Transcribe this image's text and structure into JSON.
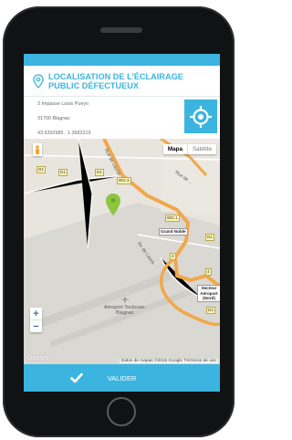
{
  "header": {
    "title": "LOCALISATION DE L’ÉCLAIRAGE PUBLIC DÉFECTUEUX",
    "pin_icon": "map-pin-icon"
  },
  "address": {
    "street": "3 Impasse Louis Pueyo",
    "city": "31700 Blagnac",
    "coordinates": "43.6392985 , 1.3682219"
  },
  "locate_button": {
    "icon": "crosshair-locate-icon"
  },
  "map": {
    "type_map": "Mapa",
    "type_satellite": "Satélite",
    "road_labels": [
      "902.3",
      "902.1",
      "D1",
      "D1",
      "D1",
      "D1",
      "4",
      "4",
      "D1"
    ],
    "place_labels": [
      "Rue de Lauras",
      "Av. de Lauris",
      "Rue de ..."
    ],
    "grand_noble": "Grand Noble",
    "secteur": "Secteur Aéroport (Nord)",
    "airport_name": "Aéroport Toulouse-Blagnac",
    "google": "Google",
    "attribution": "Datos de mapas ©2015 Google  Términos de uso",
    "zoom_in": "+",
    "zoom_out": "−"
  },
  "footer": {
    "valider_label": "VALIDER"
  },
  "colors": {
    "accent": "#3bb4e0",
    "marker": "#8cc63f",
    "highway": "#f1a84a"
  }
}
